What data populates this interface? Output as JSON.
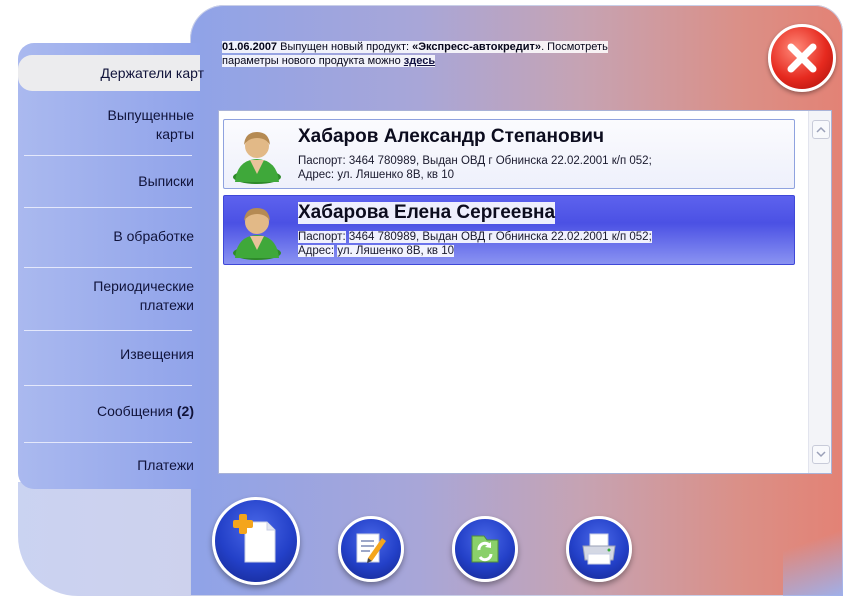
{
  "sidebar": {
    "items": [
      {
        "label": "Держатели карт",
        "active": true
      },
      {
        "label": "Выпущенные\nкарты"
      },
      {
        "label": "Выписки"
      },
      {
        "label": "В обработке"
      },
      {
        "label": "Периодические\nплатежи"
      },
      {
        "label": "Извещения"
      },
      {
        "label": "Сообщения",
        "count": "(2)"
      },
      {
        "label": "Платежи"
      }
    ]
  },
  "news": {
    "date": "01.06.2007",
    "text_part1": "Выпущен новый продукт:",
    "product": "«Экспресс-автокредит»",
    "text_part2": ". Посмотреть",
    "text_line2": "параметры нового продукта можно",
    "link": "здесь"
  },
  "holders": [
    {
      "name": "Хабаров Александр Степанович",
      "passport_label": "Паспорт:",
      "passport": "3464 780989, Выдан ОВД г Обнинска 22.02.2001 к/п 052;",
      "address_label": "Адрес:",
      "address": "ул. Ляшенко 8В, кв 10",
      "selected": false
    },
    {
      "name": "Хабарова Елена Сергеевна",
      "passport_label": "Паспорт:",
      "passport": "3464 780989, Выдан ОВД г Обнинска 22.02.2001 к/п 052;",
      "address_label": "Адрес:",
      "address": "ул. Ляшенко 8В, кв 10",
      "selected": true
    }
  ],
  "toolbar": {
    "buttons": [
      {
        "icon": "add-document-icon"
      },
      {
        "icon": "edit-icon"
      },
      {
        "icon": "refresh-icon"
      },
      {
        "icon": "print-icon"
      }
    ]
  },
  "icons": {
    "close": "close-icon",
    "avatar": "person-avatar-icon"
  },
  "colors": {
    "accent": "#4b51e4",
    "close": "#e62a1f",
    "toolbar": "#2340c8"
  }
}
